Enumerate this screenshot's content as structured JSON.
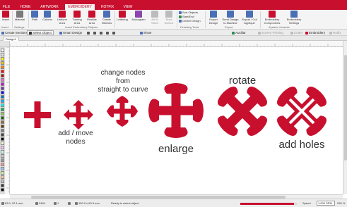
{
  "app": {
    "title": "",
    "file_tab": "FILE",
    "tabs": [
      "HOME",
      "ARTWORK",
      "EMBROIDERY",
      "HOTFIX",
      "VIEW"
    ],
    "active_tab_index": 2,
    "brand_color": "#c8102e"
  },
  "ribbon": {
    "insert": "Insert",
    "material": "Material",
    "path": "Path",
    "column": "Column",
    "uniform_area": "Uniform Area",
    "turning_area": "Turning Area",
    "flexible_area": "Flexible Area",
    "create_stitches": "Create Stitches",
    "lettering": "Lettering",
    "monogram": "Monogram",
    "art_to_stitch": "Art to Stitch",
    "team_names": "Team Names",
    "sort_objects": "Sort Objects",
    "start_end": "Start/End",
    "center_design": "Center Design",
    "export_design": "Export Design",
    "send_design": "Send Design to Machine",
    "export_cut": "Export / Cut Applique",
    "embroidery_components": "Embroidery Components",
    "embroidery_settings": "Embroidery Settings",
    "groups": {
      "insert": "Insert",
      "settings": "Settings",
      "insert_objects": "Insert Embroidery Objects",
      "finishing": "Finishing Tools",
      "export": "Export",
      "libraries": "System Libraries"
    }
  },
  "toolbar": {
    "create_sections": "Create Sections",
    "select_object": "Select Object",
    "smart_design": "Smart Design",
    "show": "Show",
    "auxiliar": "Auxiliar",
    "screen_printing": "Screen Printing",
    "cutter": "Cutter",
    "embroidery": "Embroidery",
    "hotfix": "Hotfix"
  },
  "document": {
    "tab_label": "Design1"
  },
  "canvas": {
    "fill_color": "#c8102e",
    "label_add_move": [
      "add / move",
      "nodes"
    ],
    "label_change_nodes": [
      "change nodes",
      "from",
      "straight to curve"
    ],
    "label_enlarge": "enlarge",
    "label_rotate": "rotate",
    "label_add_holes": "add holes"
  },
  "palette": {
    "colors": [
      "#ffffff",
      "#f2f2f2",
      "#ffff00",
      "#ffc000",
      "#ff8000",
      "#ff0000",
      "#c00000",
      "#ff66cc",
      "#cc00cc",
      "#7030a0",
      "#0000ff",
      "#0070c0",
      "#00b0f0",
      "#00ffff",
      "#00b050",
      "#92d050",
      "#006600",
      "#996633",
      "#663300",
      "#808080",
      "#404040",
      "#000000",
      "#ffffcc",
      "#ffccff",
      "#ccffff",
      "#cccccc",
      "#999999",
      "#ff9999",
      "#99ccff",
      "#ccff99",
      "#ffcc99",
      "#c0c0c0",
      "#333333",
      "#000000"
    ]
  },
  "status": {
    "coords": "63.0, 22.1 mm",
    "stitches": "3494",
    "colors_count": "1",
    "size": "150.0 x 60.3 mm",
    "message": "Ready to select object",
    "speed_label": "Speed",
    "speed_fraction": 0.95,
    "speed_value": "1,000 SPM",
    "zoom": "290 %"
  }
}
